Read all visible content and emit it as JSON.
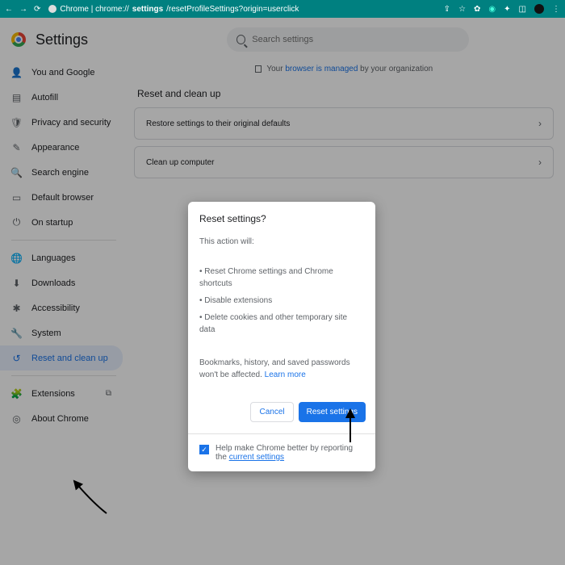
{
  "titlebar": {
    "url_prefix": "Chrome | chrome://",
    "url_bold": "settings",
    "url_rest": "/resetProfileSettings?origin=userclick"
  },
  "header": {
    "title": "Settings",
    "search_placeholder": "Search settings"
  },
  "managed": {
    "prefix": "Your ",
    "link": "browser is managed",
    "suffix": " by your organization"
  },
  "section_title": "Reset and clean up",
  "cards": {
    "row1": "Restore settings to their original defaults",
    "row2": "Clean up computer"
  },
  "sidebar": {
    "you": "You and Google",
    "autofill": "Autofill",
    "privacy": "Privacy and security",
    "appearance": "Appearance",
    "search": "Search engine",
    "default": "Default browser",
    "startup": "On startup",
    "languages": "Languages",
    "downloads": "Downloads",
    "accessibility": "Accessibility",
    "system": "System",
    "reset": "Reset and clean up",
    "extensions": "Extensions",
    "about": "About Chrome"
  },
  "dialog": {
    "title": "Reset settings?",
    "intro": "This action will:",
    "b1": "• Reset Chrome settings and Chrome shortcuts",
    "b2": "• Disable extensions",
    "b3": "• Delete cookies and other temporary site data",
    "note": "Bookmarks, history, and saved passwords won't be affected. ",
    "learn": "Learn more",
    "cancel": "Cancel",
    "confirm": "Reset settings",
    "help": "Help make Chrome better by reporting the ",
    "help_link": "current settings"
  }
}
